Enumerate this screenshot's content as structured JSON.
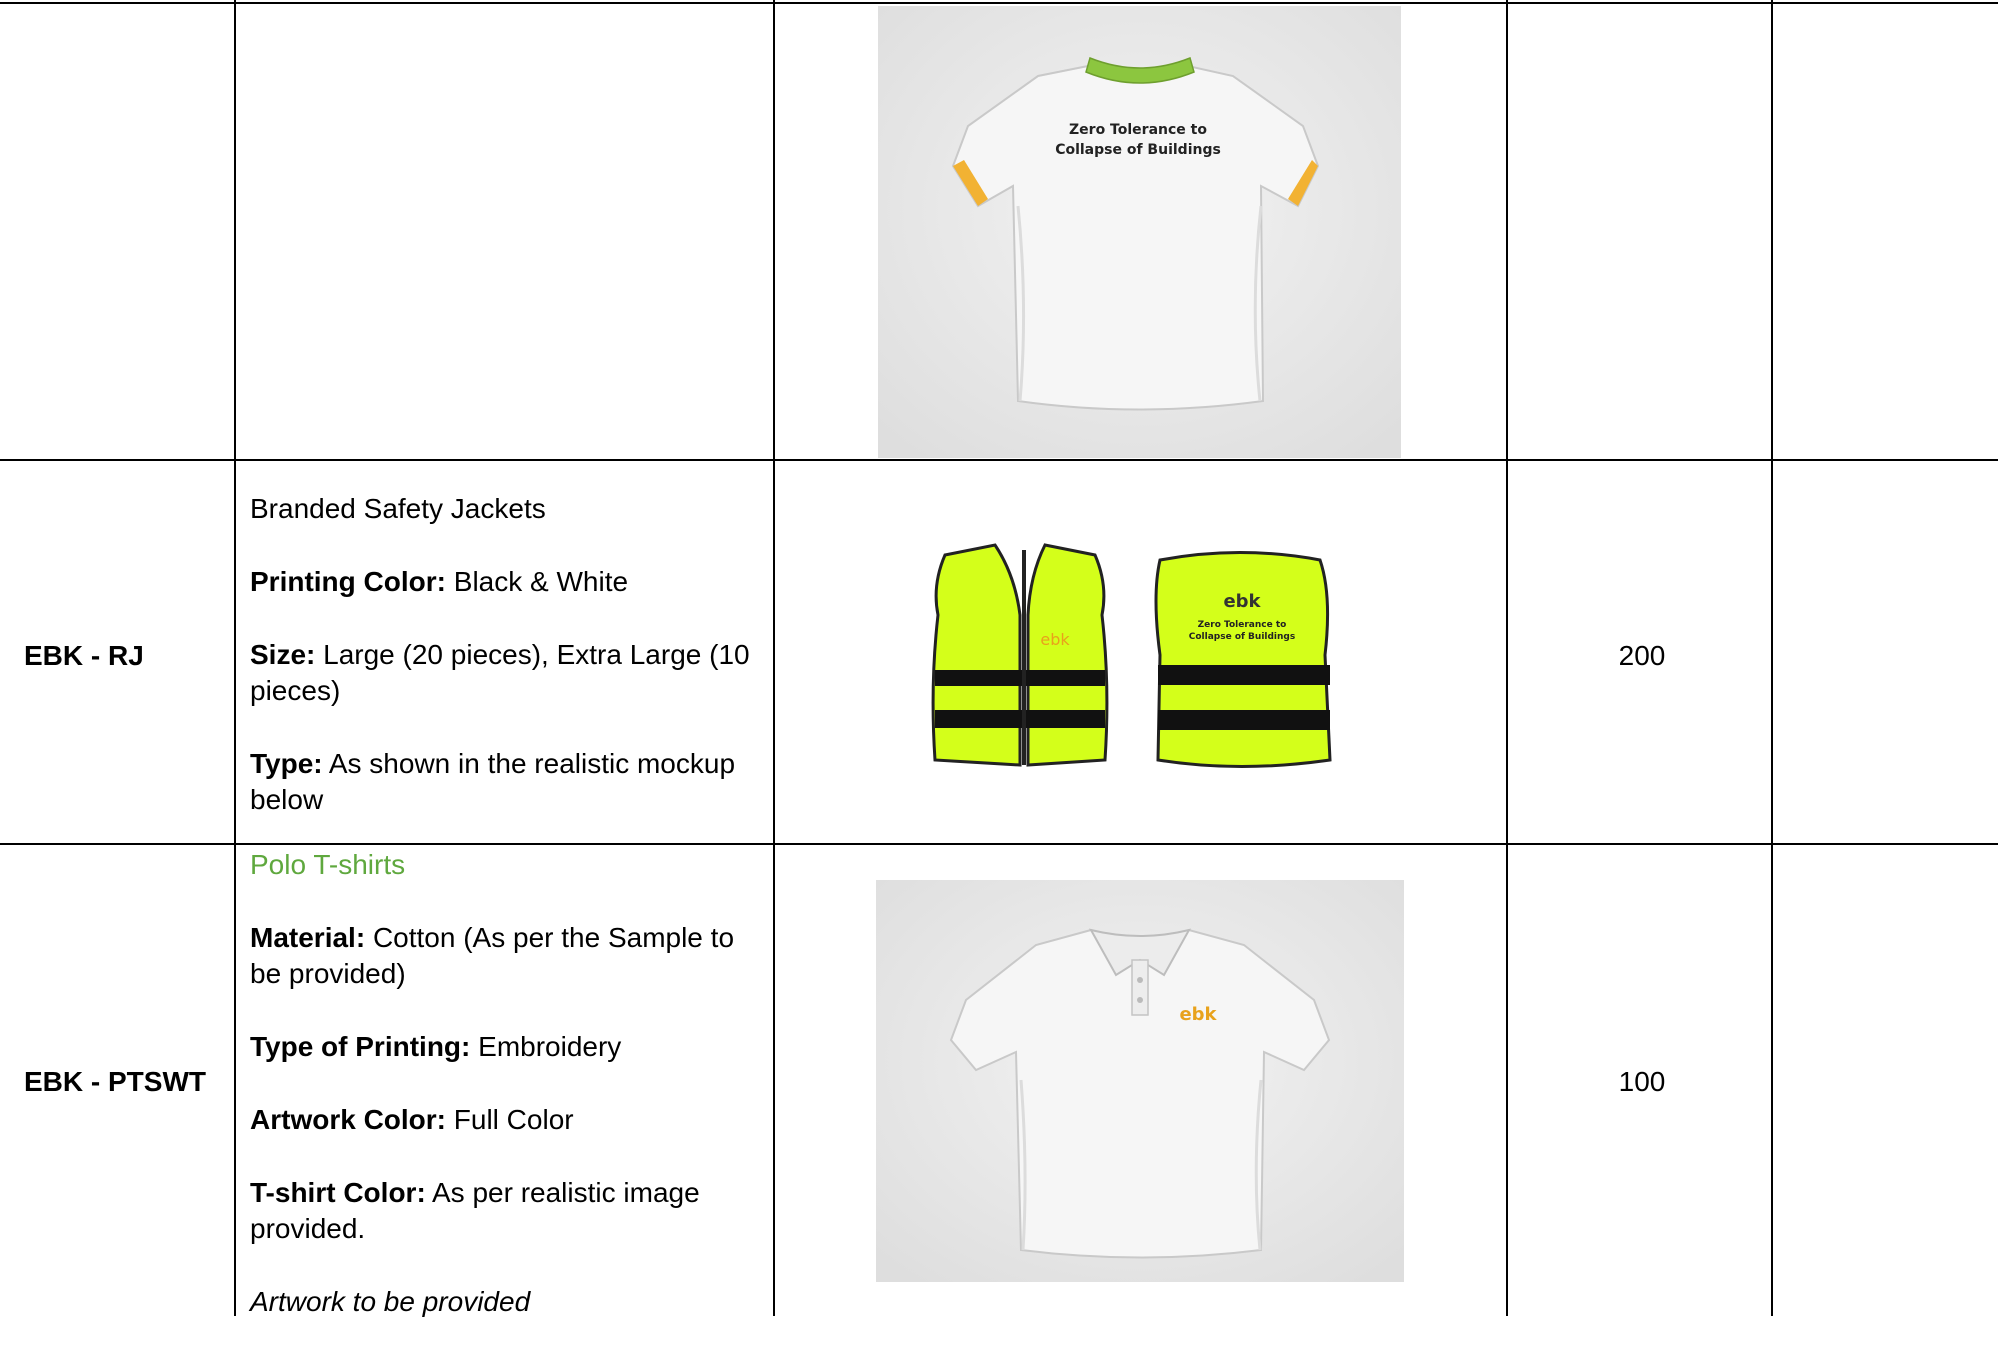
{
  "rows": [
    {
      "code": "",
      "quantity": "",
      "image": {
        "shirt_color": "#f4f4f4",
        "collar_color": "#8cc63f",
        "sleeve_band_color": "#f2b233",
        "back_text_line1": "Zero Tolerance to",
        "back_text_line2": "Collapse of Buildings"
      }
    },
    {
      "code": "EBK - RJ",
      "title": "Branded Safety Jackets",
      "printing_color_label": "Printing Color:",
      "printing_color_value": "Black & White",
      "size_label": "Size:",
      "size_value": "Large (20 pieces), Extra Large (10 pieces)",
      "type_label": "Type:",
      "type_value": "As shown in the realistic mockup below",
      "quantity": "200",
      "image": {
        "vest_color": "#d4ff1a",
        "stripe_color": "#111111",
        "logo_text": "ebk",
        "back_text_line1": "Zero Tolerance to",
        "back_text_line2": "Collapse of Buildings"
      }
    },
    {
      "code": "EBK - PTSWT",
      "title": "Polo T-shirts",
      "material_label": "Material:",
      "material_value": "Cotton (As per the Sample to be provided)",
      "printing_type_label": "Type of Printing:",
      "printing_type_value": "Embroidery",
      "artwork_color_label": "Artwork Color:",
      "artwork_color_value": "Full Color",
      "tshirt_color_label": "T-shirt Color:",
      "tshirt_color_value": "As per realistic image provided.",
      "artwork_note": "Artwork to be provided",
      "quantity": "100",
      "image": {
        "shirt_color": "#f4f4f4",
        "logo_text": "ebk"
      }
    }
  ],
  "colors": {
    "title_green": "#5fa83e",
    "border": "#000000",
    "logo_orange": "#e8a21c",
    "logo_dark": "#333333"
  }
}
